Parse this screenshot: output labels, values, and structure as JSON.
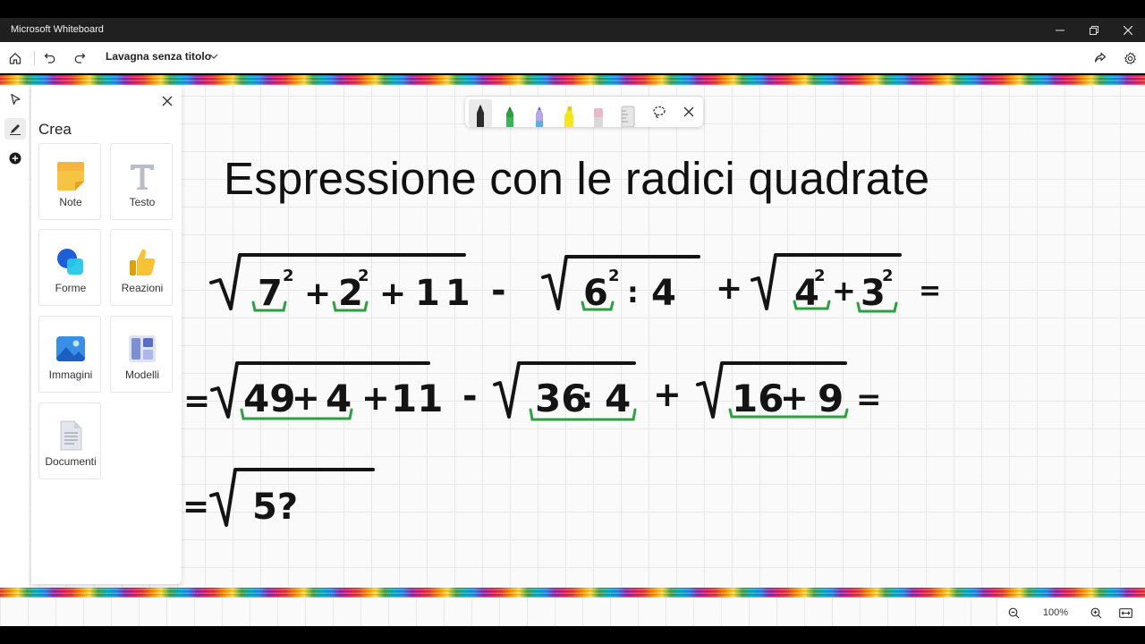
{
  "window": {
    "title": "Microsoft Whiteboard"
  },
  "toolbar": {
    "board_name": "Lavagna senza titolo"
  },
  "create_panel": {
    "title": "Crea",
    "tiles": [
      {
        "label": "Note",
        "icon": "sticky-note-icon"
      },
      {
        "label": "Testo",
        "icon": "text-icon"
      },
      {
        "label": "Forme",
        "icon": "shapes-icon"
      },
      {
        "label": "Reazioni",
        "icon": "thumbs-up-icon"
      },
      {
        "label": "Immagini",
        "icon": "image-icon"
      },
      {
        "label": "Modelli",
        "icon": "templates-icon"
      },
      {
        "label": "Documenti",
        "icon": "document-icon"
      }
    ]
  },
  "pen_toolbar": {
    "tools": [
      "black-pen",
      "green-pen",
      "multicolor-pen",
      "yellow-highlighter",
      "eraser",
      "ruler",
      "lasso",
      "close"
    ],
    "colors": {
      "black": "#1a1a1a",
      "green": "#2e9e44",
      "highlighter": "#f5e51b"
    }
  },
  "board": {
    "title": "Espressione con le radici quadrate",
    "line1": {
      "t1_base": "7",
      "t1_exp": "2",
      "op1": "+",
      "t2_base": "2",
      "t2_exp": "2",
      "op2": "+",
      "t3": "11",
      "minus": "-",
      "t4_base": "6",
      "t4_exp": "2",
      "colon": ":",
      "t5": "4",
      "plus": "+",
      "t6_base": "4",
      "t6_exp": "2",
      "op3": "+",
      "t7_base": "3",
      "t7_exp": "2",
      "eq": "="
    },
    "line2": {
      "eq_start": "=",
      "a1": "49",
      "op1": "+",
      "a2": "4",
      "op2": "+",
      "a3": "11",
      "minus": "-",
      "b1": "36",
      "colon": ":",
      "b2": "4",
      "plus": "+",
      "c1": "16",
      "op3": "+",
      "c2": "9",
      "eq_end": "="
    },
    "line3": {
      "eq_start": "=",
      "partial": "5?"
    },
    "ink_colors": {
      "main": "#141414",
      "underline": "#2ea043"
    }
  },
  "zoom": {
    "level": "100%"
  }
}
